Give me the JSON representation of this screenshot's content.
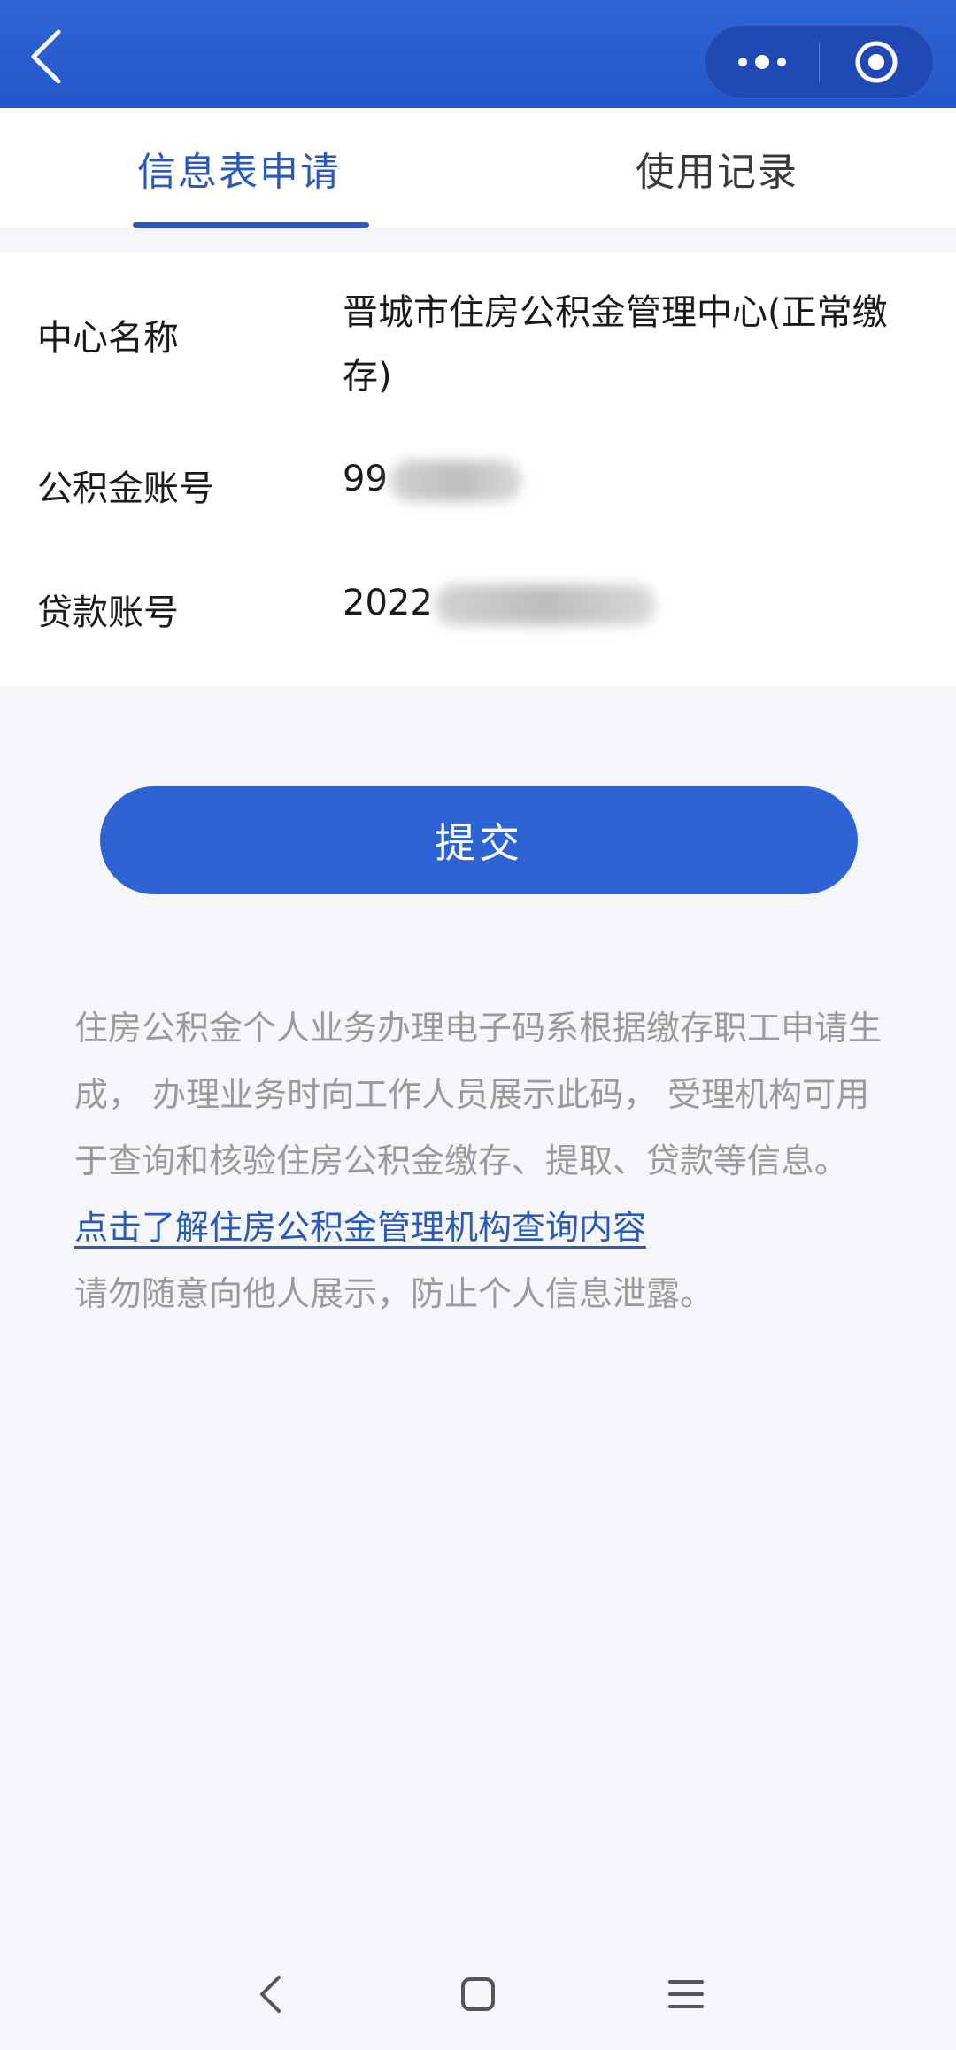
{
  "header": {
    "back_icon": "chevron-left-icon",
    "more_icon": "more-dots-icon",
    "close_icon": "target-circle-icon",
    "bar_color": "#2a5fd0"
  },
  "tabs": [
    {
      "label": "信息表申请",
      "active": true
    },
    {
      "label": "使用记录",
      "active": false
    }
  ],
  "info": {
    "center_name_label": "中心名称",
    "center_name_value": "晋城市住房公积金管理中心(正常缴存)",
    "fund_account_label": "公积金账号",
    "fund_account_prefix": "99",
    "loan_account_label": "贷款账号",
    "loan_account_prefix": "2022"
  },
  "submit": {
    "label": "提交",
    "color": "#2e63d6"
  },
  "notice": {
    "paragraph": "住房公积金个人业务办理电子码系根据缴存职工申请生成， 办理业务时向工作人员展示此码， 受理机构可用于查询和核验住房公积金缴存、提取、贷款等信息。",
    "link": "点击了解住房公积金管理机构查询内容",
    "warning": "请勿随意向他人展示，防止个人信息泄露。"
  },
  "system_nav": {
    "back_icon": "system-back-icon",
    "home_icon": "system-home-icon",
    "menu_icon": "system-menu-icon"
  }
}
